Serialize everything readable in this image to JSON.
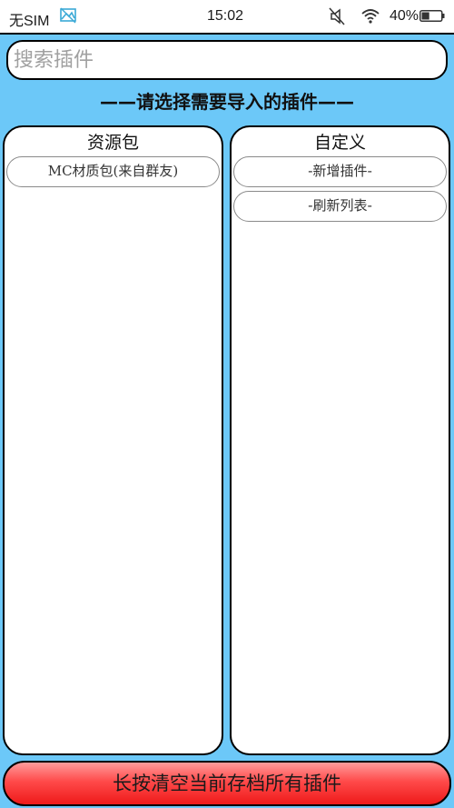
{
  "statusbar": {
    "carrier": "无SIM",
    "carrier_icon": "image-icon",
    "time": "15:02",
    "mute_icon": "mute-icon",
    "wifi_icon": "wifi-icon",
    "battery_text": "40%",
    "battery_level": 0.4
  },
  "search": {
    "placeholder": "搜索插件",
    "value": ""
  },
  "heading": "——请选择需要导入的插件——",
  "panels": {
    "left": {
      "title": "资源包",
      "items": [
        "MC材质包(来自群友)"
      ]
    },
    "right": {
      "title": "自定义",
      "items": [
        "-新增插件-",
        "-刷新列表-"
      ]
    }
  },
  "bottom_button": {
    "label": "长按清空当前存档所有插件"
  },
  "colors": {
    "app_background": "#6cc8f8",
    "bottom_button": "#ff4a4a",
    "carrier_icon": "#3aa9d6"
  }
}
